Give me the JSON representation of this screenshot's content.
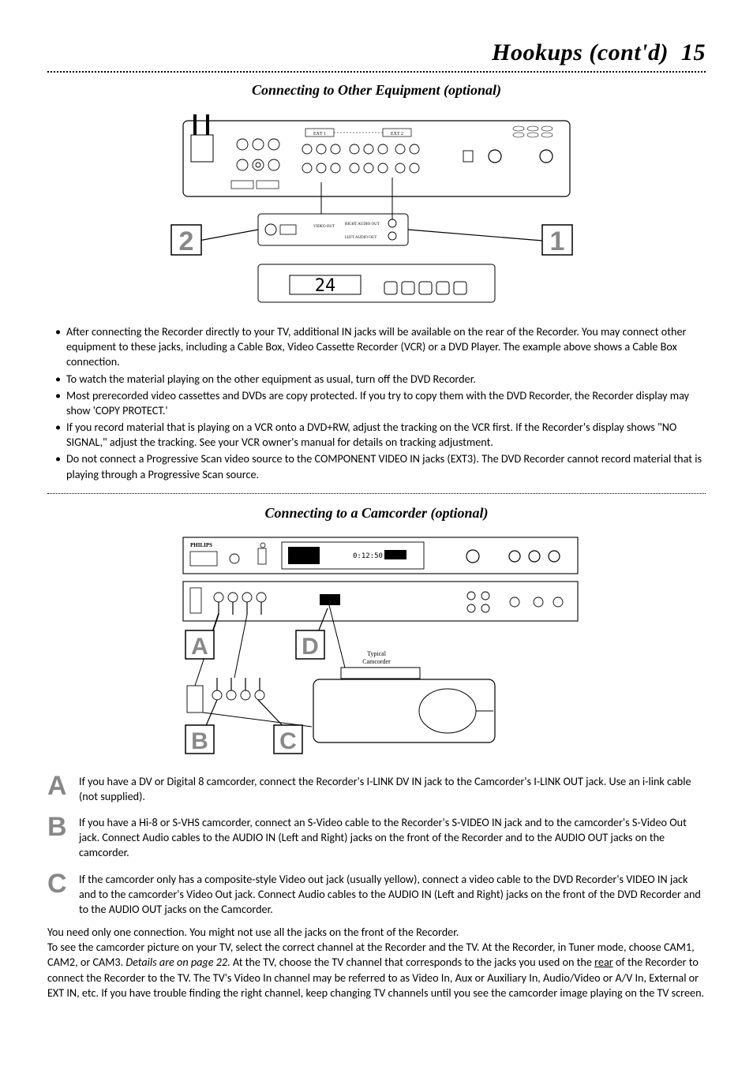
{
  "header": {
    "title": "Hookups (cont'd)",
    "page_number": "15"
  },
  "section1": {
    "heading": "Connecting to Other Equipment (optional)",
    "diagram": {
      "label_1": "1",
      "label_2": "2",
      "display_text": "24",
      "camera_video_out": "VIDEO OUT",
      "camera_right_audio": "RIGHT AUDIO OUT",
      "camera_left_audio": "LEFT AUDIO OUT",
      "panel_ext1": "EXT 1",
      "panel_ext2": "EXT 2"
    },
    "bullets": [
      "After connecting the Recorder directly to your TV, additional IN jacks will be available on the rear of the Recorder. You may connect other equipment to these jacks, including a Cable Box, Video Cassette Recorder (VCR) or a DVD Player. The example above shows a Cable Box connection.",
      "To watch the material playing on the other equipment as usual, turn off the DVD Recorder.",
      "Most prerecorded video cassettes and DVDs are copy protected. If you try to copy them with the DVD Recorder, the Recorder display may show 'COPY PROTECT.'",
      "If you record material that is playing on a VCR onto a DVD+RW, adjust the tracking on the VCR first. If the Recorder's display shows \"NO SIGNAL,\" adjust the tracking. See your VCR owner's manual for details on tracking adjustment.",
      "Do not connect a Progressive Scan video source to the COMPONENT VIDEO IN jacks (EXT3). The DVD Recorder cannot record material that is playing through a Progressive Scan source."
    ]
  },
  "section2": {
    "heading": "Connecting to a Camcorder (optional)",
    "diagram": {
      "label_a": "A",
      "label_b": "B",
      "label_c": "C",
      "label_d": "D",
      "camcorder_label": "Typical Camcorder",
      "brand": "PHILIPS",
      "panel_timer": "0:12:50"
    },
    "letters": {
      "a": {
        "letter": "A",
        "text": "If you have a DV or Digital 8 camcorder, connect the Recorder's I-LINK DV IN jack to the Camcorder's I-LINK OUT jack. Use an i-link cable (not supplied)."
      },
      "b": {
        "letter": "B",
        "text": "If you have a Hi-8 or S-VHS camcorder, connect an S-Video cable to the Recorder's S-VIDEO IN jack and to the camcorder's S-Video Out jack. Connect Audio cables to the AUDIO IN (Left and Right) jacks on the front of the Recorder and to the AUDIO OUT jacks on the camcorder."
      },
      "c": {
        "letter": "C",
        "text": "If the camcorder only has a composite-style Video out jack (usually yellow), connect a video cable to the DVD Recorder's VIDEO IN jack and to the camcorder's Video Out jack. Connect Audio cables to the AUDIO IN (Left and Right) jacks on the front of the DVD Recorder and to the AUDIO OUT jacks on the Camcorder."
      }
    },
    "bottom_paragraph": {
      "line1": "You need only one connection. You might not use all the jacks on the front of the Recorder.",
      "sentence_pre_italic": "To see the camcorder picture on your TV, select the correct channel at the Recorder and the TV. At the Recorder, in Tuner mode, choose CAM1, CAM2, or CAM3.",
      "italic_part": "Details are on page 22.",
      "sentence_post_italic_pre_rear": "At the TV, choose the TV channel that corresponds to the jacks you used on the ",
      "rear_word": "rear",
      "after_rear": " of the Recorder to connect the Recorder to the TV. The TV's Video In channel may be referred to as Video In, Aux or Auxiliary In, Audio/Video or A/V In, External or EXT IN, etc. If you have trouble finding the right channel, keep changing TV channels until you see the camcorder image playing on the TV screen."
    }
  }
}
